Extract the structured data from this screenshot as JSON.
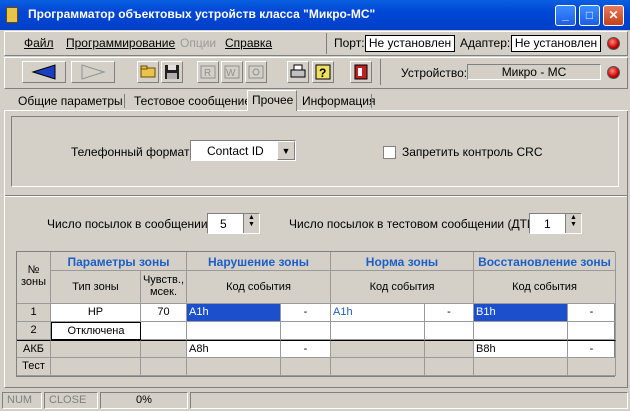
{
  "window": {
    "title": "Программатор объектовых устройств класса \"Микро-МС\"",
    "controls": [
      "minimize",
      "maximize",
      "close"
    ]
  },
  "menu": {
    "file": "Файл",
    "programming": "Программирование",
    "options": "Опции",
    "help": "Справка"
  },
  "status": {
    "port_label": "Порт:",
    "port_value": "Не установлен",
    "adapter_label": "Адаптер:",
    "adapter_value": "Не установлен",
    "device_label": "Устройство:",
    "device_value": "Микро - МС"
  },
  "tabs": [
    {
      "label": "Общие  параметры",
      "active": false
    },
    {
      "label": "Тестовое сообщение",
      "active": false
    },
    {
      "label": "Прочее",
      "active": true
    },
    {
      "label": "Информация",
      "active": false
    }
  ],
  "form": {
    "phone_format_label": "Телефонный формат:",
    "phone_format_value": "Contact ID",
    "crc_label": "Запретить контроль CRC",
    "crc_checked": false,
    "packets_label": "Число посылок в сообщении:",
    "packets_value": "5",
    "test_packets_label": "Число посылок в тестовом сообщении (ДТИ):",
    "test_packets_value": "1"
  },
  "grid": {
    "col_zone_no": "№\nзоны",
    "group_params": "Параметры зоны",
    "group_violation": "Нарушение  зоны",
    "group_norm": "Норма зоны",
    "group_restore": "Восстановление зоны",
    "sub_zone_type": "Тип зоны",
    "sub_sens": "Чувств.,\nмсек.",
    "sub_event_code": "Код события",
    "rows": [
      {
        "no": "1",
        "type": "НР",
        "sens": "70",
        "viol": "A1h",
        "viol2": "-",
        "norm": "A1h",
        "norm2": "-",
        "rest": "B1h",
        "rest2": "-"
      },
      {
        "no": "2",
        "type": "Отключена",
        "sens": "",
        "viol": "",
        "viol2": "",
        "norm": "",
        "norm2": "",
        "rest": "",
        "rest2": ""
      },
      {
        "no": "АКБ",
        "type": "",
        "sens": "",
        "viol": "A8h",
        "viol2": "-",
        "norm": "",
        "norm2": "",
        "rest": "B8h",
        "rest2": "-"
      },
      {
        "no": "Тест",
        "type": "",
        "sens": "",
        "viol": "",
        "viol2": "",
        "norm": "",
        "norm2": "",
        "rest": "",
        "rest2": ""
      }
    ]
  },
  "statusbar": {
    "num": "NUM",
    "close": "CLOSE",
    "progress": "0%"
  },
  "colors": {
    "accent_blue": "#1c5ec8",
    "selection": "#1c4fcc",
    "led_red": "#c80000"
  }
}
